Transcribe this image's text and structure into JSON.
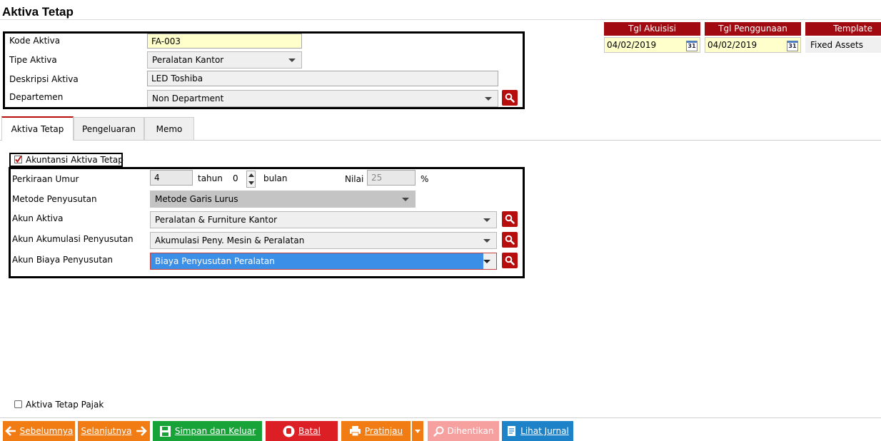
{
  "page": {
    "title": "Aktiva Tetap"
  },
  "header_form": {
    "kode_label": "Kode Aktiva",
    "kode_value": "FA-003",
    "tipe_label": "Tipe Aktiva",
    "tipe_value": "Peralatan Kantor",
    "deskripsi_label": "Deskripsi Aktiva",
    "deskripsi_value": "LED Toshiba",
    "departemen_label": "Departemen",
    "departemen_value": "Non Department"
  },
  "dates": {
    "akuisisi_header": "Tgl Akuisisi",
    "akuisisi_value": "04/02/2019",
    "penggunaan_header": "Tgl Penggunaan",
    "penggunaan_value": "04/02/2019",
    "template_header": "Template",
    "template_value": "Fixed Assets",
    "calendar_icon_text": "31"
  },
  "tabs": [
    {
      "label": "Aktiva Tetap",
      "active": true
    },
    {
      "label": "Pengeluaran",
      "active": false
    },
    {
      "label": "Memo",
      "active": false
    }
  ],
  "akuntansi": {
    "checkbox_label": "Akuntansi Aktiva Tetap",
    "checked": true,
    "umur_label": "Perkiraan Umur",
    "umur_tahun_value": "4",
    "tahun_label": "tahun",
    "bulan_value": "0",
    "bulan_label": "bulan",
    "nilai_label": "Nilai",
    "nilai_value": "25",
    "percent_label": "%",
    "metode_label": "Metode Penyusutan",
    "metode_value": "Metode Garis Lurus",
    "akun_aktiva_label": "Akun Aktiva",
    "akun_aktiva_value": "Peralatan & Furniture Kantor",
    "akun_akumulasi_label": "Akun Akumulasi Penyusutan",
    "akun_akumulasi_value": "Akumulasi Peny. Mesin & Peralatan",
    "akun_biaya_label": "Akun Biaya Penyusutan",
    "akun_biaya_value": "Biaya Penyusutan Peralatan"
  },
  "pajak": {
    "label": "Aktiva Tetap Pajak",
    "checked": false
  },
  "footer": {
    "prev_label": "Sebelumnya",
    "next_label": "Selanjutnya",
    "save_label": "Simpan dan Keluar",
    "cancel_label": "Batal",
    "preview_label": "Pratinjau",
    "stop_label": "Dihentikan",
    "journal_label": "Lihat Jurnal"
  },
  "colors": {
    "header_red": "#a10a10",
    "search_red": "#b80d0d",
    "orange": "#f07c13",
    "green": "#17a338",
    "red": "#db1f24",
    "pink": "#f6a0a0",
    "blue": "#1d82c8",
    "yellow_field": "#ffffcc",
    "selection_blue": "#3b8fe6"
  }
}
